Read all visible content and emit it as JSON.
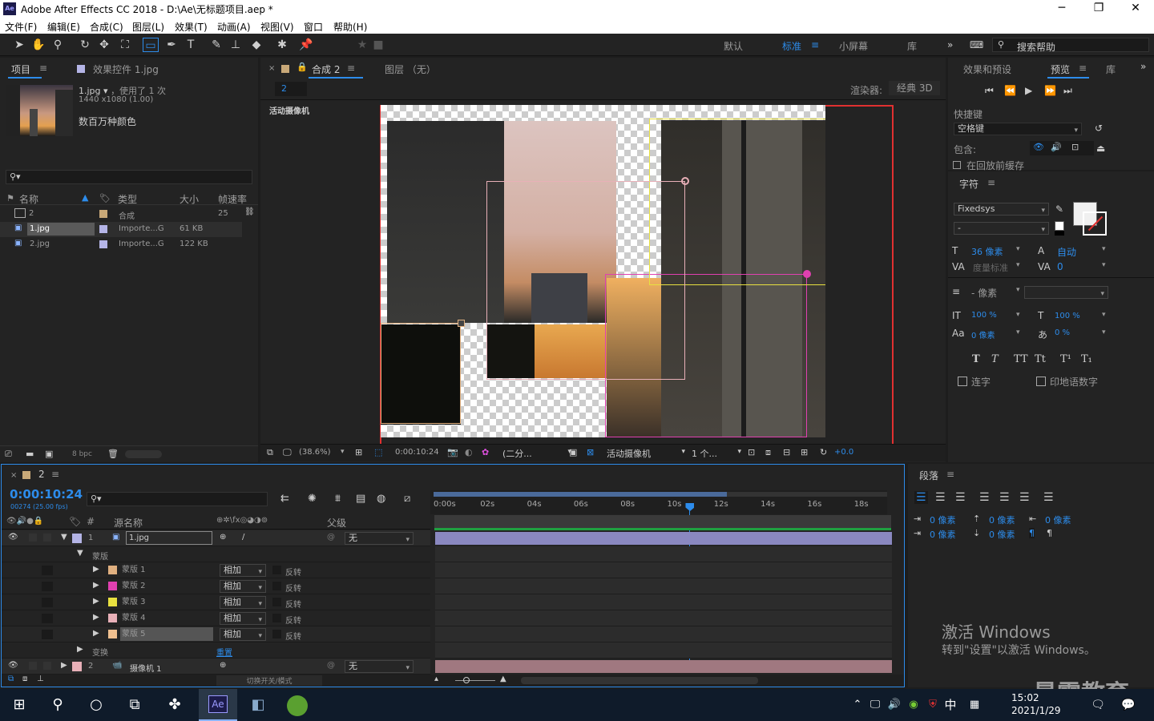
{
  "window": {
    "title": "Adobe After Effects CC 2018 - D:\\Ae\\无标题项目.aep *",
    "app_icon": "Ae"
  },
  "menu": [
    "文件(F)",
    "编辑(E)",
    "合成(C)",
    "图层(L)",
    "效果(T)",
    "动画(A)",
    "视图(V)",
    "窗口",
    "帮助(H)"
  ],
  "toolbar": {
    "workspaces": [
      "默认",
      "标准",
      "小屏幕",
      "库"
    ],
    "active_workspace": "标准",
    "search_placeholder": "搜索帮助"
  },
  "project_panel": {
    "tab_project": "项目",
    "tab_effects": "效果控件 1.jpg",
    "item_name": "1.jpg",
    "usage": "，使用了 1 次",
    "dimensions": "1440 x1080 (1.00)",
    "colors": "数百万种颜色",
    "search_placeholder": "",
    "columns": [
      "名称",
      "类型",
      "大小",
      "帧速率"
    ],
    "rows": [
      {
        "name": "2",
        "type": "合成",
        "size": "",
        "fps": "25",
        "color": "#c8a878"
      },
      {
        "name": "1.jpg",
        "type": "Importe...G",
        "size": "61 KB",
        "fps": "",
        "color": "#b4b4e6"
      },
      {
        "name": "2.jpg",
        "type": "Importe...G",
        "size": "122 KB",
        "fps": "",
        "color": "#b4b4e6"
      }
    ],
    "bpc": "8 bpc"
  },
  "comp_panel": {
    "tab_comp": "合成 2",
    "tab_layer": "图层 （无）",
    "breadcrumb": "2",
    "renderer_label": "渲染器:",
    "renderer_value": "经典 3D",
    "camera_label": "活动摄像机",
    "zoom": "(38.6%)",
    "timecode": "0:00:10:24",
    "resolution": "(二分...",
    "view": "活动摄像机",
    "views_count": "1 个...",
    "exposure": "+0.0"
  },
  "right_panel": {
    "tabs": [
      "效果和预设",
      "预览",
      "库"
    ],
    "active_tab": "预览",
    "shortcut_label": "快捷键",
    "shortcut_value": "空格键",
    "include_label": "包含:",
    "cache_label": "在回放前缓存",
    "char_title": "字符",
    "font": "Fixedsys",
    "font_style": "-",
    "font_size": "36 像素",
    "leading": "自动",
    "kerning": "度量标准",
    "tracking": "0",
    "stroke": "- 像素",
    "vscale": "100 %",
    "hscale": "100 %",
    "baseline": "0 像素",
    "tsume": "0 %",
    "ligature": "连字",
    "hindi_digits": "印地语数字",
    "para_title": "段落",
    "para_values": [
      "0 像素",
      "0 像素",
      "0 像素",
      "0 像素",
      "0 像素"
    ]
  },
  "timeline": {
    "comp_tab": "2",
    "timecode": "0:00:10:24",
    "frames": "00274 (25.00 fps)",
    "search_placeholder": "",
    "col_source": "源名称",
    "col_parent": "父级",
    "ruler": [
      "0:00s",
      "02s",
      "04s",
      "06s",
      "08s",
      "10s",
      "12s",
      "14s",
      "16s",
      "18s"
    ],
    "playhead_time": 10.96,
    "layers": [
      {
        "num": "1",
        "name": "1.jpg",
        "parent": "无"
      },
      {
        "num": "2",
        "name": "摄像机 1",
        "parent": "无"
      }
    ],
    "masks_label": "蒙版",
    "masks": [
      {
        "name": "蒙版 1",
        "mode": "相加",
        "invert": "反转",
        "color": "#e0b080"
      },
      {
        "name": "蒙版 2",
        "mode": "相加",
        "invert": "反转",
        "color": "#e040b0"
      },
      {
        "name": "蒙版 3",
        "mode": "相加",
        "invert": "反转",
        "color": "#e8e040"
      },
      {
        "name": "蒙版 4",
        "mode": "相加",
        "invert": "反转",
        "color": "#e8b0b8"
      },
      {
        "name": "蒙版 5",
        "mode": "相加",
        "invert": "反转",
        "color": "#f0c090"
      }
    ],
    "transform_label": "变换",
    "reset_label": "重置",
    "switch_modes": "切换开关/模式"
  },
  "watermark": {
    "line1": "激活 Windows",
    "line2": "转到\"设置\"以激活 Windows。",
    "brand": "最需教育"
  },
  "taskbar": {
    "time": "15:02",
    "date": "2021/1/29",
    "ime": "中"
  }
}
